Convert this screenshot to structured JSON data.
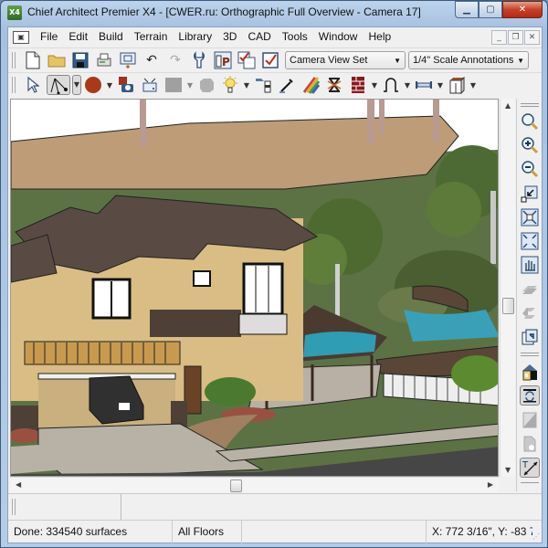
{
  "window": {
    "app_icon_label": "X4",
    "title": "Chief Architect Premier X4 - [CWER.ru: Orthographic Full Overview - Camera 17]",
    "caption": {
      "minimize": "▁",
      "maximize": "▢",
      "close": "✕"
    }
  },
  "menubar": {
    "doc_icon": "camera-doc-icon",
    "doc_icon_glyph": "▣",
    "items": [
      "File",
      "Edit",
      "Build",
      "Terrain",
      "Library",
      "3D",
      "CAD",
      "Tools",
      "Window",
      "Help"
    ],
    "mdi": {
      "minimize": "_",
      "restore": "❐",
      "close": "✕"
    }
  },
  "toolbar1": {
    "buttons": [
      {
        "name": "new-icon",
        "glyph": "🗋"
      },
      {
        "name": "open-folder-icon",
        "glyph": "📁"
      },
      {
        "name": "save-icon",
        "glyph": "💾"
      },
      {
        "name": "print-icon",
        "glyph": "🖶"
      },
      {
        "name": "plot-sheet-icon",
        "glyph": "▤"
      },
      {
        "name": "undo-icon",
        "glyph": "↶"
      },
      {
        "name": "redo-icon",
        "glyph": "↷"
      },
      {
        "name": "wrench-icon",
        "glyph": "🔧"
      },
      {
        "name": "plan-parameter-icon",
        "glyph": "P"
      },
      {
        "name": "check-layers-icon",
        "glyph": "☑"
      },
      {
        "name": "checkbox-icon",
        "glyph": "☑"
      }
    ],
    "layer_set": {
      "value": "Camera View Set"
    },
    "annotation_set": {
      "value": "1/4\" Scale Annotations"
    }
  },
  "toolbar2": {
    "buttons": [
      {
        "name": "select-arrow-icon",
        "glyph": "↖",
        "dropdown": false
      },
      {
        "name": "edit-handles-icon",
        "glyph": "⤡",
        "dropdown": true,
        "pressed": true
      },
      {
        "name": "material-sphere-icon",
        "glyph": "●",
        "dropdown": true
      },
      {
        "name": "save-camera-icon",
        "glyph": "📷",
        "dropdown": false
      },
      {
        "name": "camera-view-icon",
        "glyph": "⌂",
        "dropdown": false
      },
      {
        "name": "gray-square-icon",
        "glyph": "■",
        "dropdown": true
      },
      {
        "name": "gray-shape-icon",
        "glyph": "⬢",
        "dropdown": false
      },
      {
        "name": "light-bulb-icon",
        "glyph": "☀",
        "dropdown": true
      },
      {
        "name": "paint-bucket-icon",
        "glyph": "⛽",
        "dropdown": false
      },
      {
        "name": "eyedropper-icon",
        "glyph": "✎",
        "dropdown": false
      },
      {
        "name": "rainbow-material-icon",
        "glyph": "▰",
        "dropdown": false
      },
      {
        "name": "delete-surface-icon",
        "glyph": "⌛",
        "dropdown": false
      },
      {
        "name": "brick-wall-icon",
        "glyph": "▦",
        "dropdown": true
      },
      {
        "name": "arc-curve-icon",
        "glyph": "∩",
        "dropdown": true
      },
      {
        "name": "dimension-line-icon",
        "glyph": "⊢",
        "dropdown": true
      },
      {
        "name": "cabinet-icon",
        "glyph": "▣",
        "dropdown": true
      }
    ]
  },
  "side_toolbar": {
    "buttons": [
      {
        "name": "zoom-icon",
        "glyph": "🔍"
      },
      {
        "name": "zoom-in-icon",
        "glyph": "⊕"
      },
      {
        "name": "zoom-out-icon",
        "glyph": "⊖"
      },
      {
        "name": "undo-zoom-icon",
        "glyph": "↙"
      },
      {
        "name": "fill-window-icon",
        "glyph": "⤢"
      },
      {
        "name": "fill-window-building-icon",
        "glyph": "⤡"
      },
      {
        "name": "pan-hand-icon",
        "glyph": "✋"
      },
      {
        "name": "floor-down-icon",
        "glyph": "▱"
      },
      {
        "name": "floor-up-icon",
        "glyph": "⇐"
      },
      {
        "name": "rebuild-icon",
        "glyph": "↺"
      },
      {
        "name": "house-view-icon",
        "glyph": "⌂"
      },
      {
        "name": "refresh-view-icon",
        "glyph": "⟳",
        "pressed": true
      },
      {
        "name": "page-icon",
        "glyph": "◩"
      },
      {
        "name": "document-icon",
        "glyph": "🗎"
      },
      {
        "name": "dimension-text-icon",
        "glyph": "T",
        "pressed": true
      }
    ]
  },
  "status": {
    "message": "Done:  334540 surfaces",
    "floor": "All Floors",
    "coordinates": "X: 772 3/16\", Y: -83 7"
  },
  "scene": {
    "description": "3D rendered orthographic overview of a two-story stucco house with tile roof, stone accents, garage with black pickup truck, octagonal pergola, pool with stone retaining wall, white fence, trees and palm trunks, driveway and street",
    "colors": {
      "sky": "#ffffff",
      "dirt": "#bd9c77",
      "lawn": "#5d7244",
      "road": "#464646",
      "sidewalk": "#b8b2a6",
      "stucco": "#d9bd84",
      "roof": "#5a4a44",
      "stone": "#4e4036",
      "pool": "#3aa0b8"
    }
  }
}
